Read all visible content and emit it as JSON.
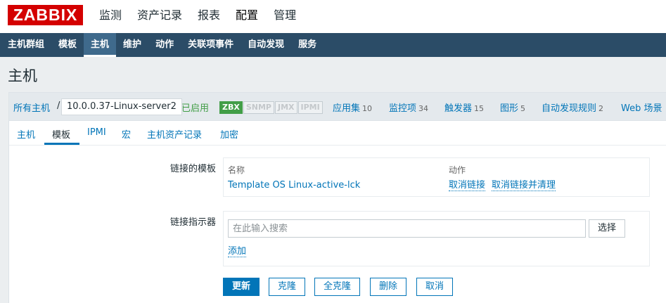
{
  "logo": "ZABBIX",
  "main_menu": [
    "监测",
    "资产记录",
    "报表",
    "配置",
    "管理"
  ],
  "sub_menu": [
    "主机群组",
    "模板",
    "主机",
    "维护",
    "动作",
    "关联项事件",
    "自动发现",
    "服务"
  ],
  "page_title": "主机",
  "host_nav": {
    "all_hosts": "所有主机",
    "separator": "/",
    "current_host": "10.0.0.37-Linux-server2",
    "status": "已启用",
    "availability": [
      "ZBX",
      "SNMP",
      "JMX",
      "IPMI"
    ],
    "links": [
      {
        "label": "应用集",
        "count": "10"
      },
      {
        "label": "监控项",
        "count": "34"
      },
      {
        "label": "触发器",
        "count": "15"
      },
      {
        "label": "图形",
        "count": "5"
      },
      {
        "label": "自动发现规则",
        "count": "2"
      },
      {
        "label": "Web 场景",
        "count": ""
      }
    ]
  },
  "tabs": [
    "主机",
    "模板",
    "IPMI",
    "宏",
    "主机资产记录",
    "加密"
  ],
  "linked_templates": {
    "label": "链接的模板",
    "col_name": "名称",
    "col_action": "动作",
    "template_name": "Template OS Linux-active-lck",
    "unlink": "取消链接",
    "unlink_clear": "取消链接并清理"
  },
  "link_indicator": {
    "label": "链接指示器",
    "placeholder": "在此输入搜索",
    "select_button": "选择",
    "add_link": "添加"
  },
  "actions": {
    "update": "更新",
    "clone": "克隆",
    "full_clone": "全克隆",
    "delete": "删除",
    "cancel": "取消"
  },
  "colors": {
    "accent": "#0275b8",
    "nav_bar": "#2b4c67",
    "logo": "#d40000",
    "enabled": "#429e47"
  }
}
